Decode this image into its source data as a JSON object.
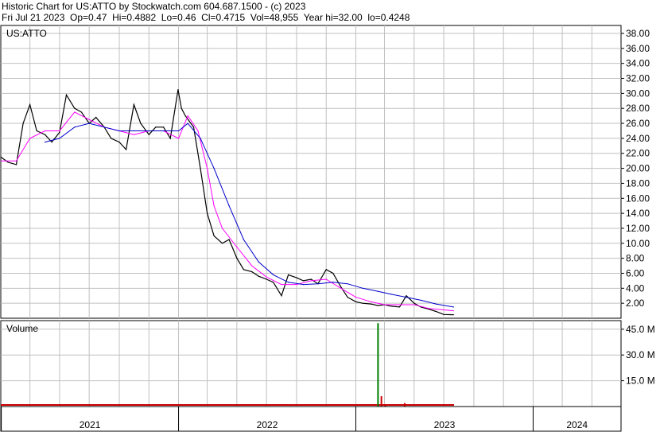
{
  "header": {
    "line1": "Historic Chart for US:ATTO by Stockwatch.com 604.687.1500 - (c) 2023",
    "line2": "Fri Jul 21 2023  Op=0.47  Hi=0.4882  Lo=0.46  Cl=0.4715  Vol=48,955  Year hi=32.00  lo=0.4248"
  },
  "colors": {
    "price": "#000000",
    "ma_short": "#ff00ff",
    "ma_long": "#0000cc",
    "volume_up": "#008000",
    "volume_down": "#cc0000",
    "grid": "#c0c0c0"
  },
  "chart_data": [
    {
      "type": "line",
      "symbol": "US:ATTO",
      "ylim": [
        0,
        38
      ],
      "yticks": [
        "38.00",
        "36.00",
        "34.00",
        "32.00",
        "30.00",
        "28.00",
        "26.00",
        "24.00",
        "22.00",
        "20.00",
        "18.00",
        "16.00",
        "14.00",
        "12.00",
        "10.00",
        "8.00",
        "6.00",
        "4.00",
        "2.00"
      ],
      "x_labels": [
        "2021",
        "2022",
        "2023",
        "2024"
      ],
      "grid": true,
      "series": [
        {
          "role": "price",
          "x": [
            "2020-12-31",
            "2021-01-15",
            "2021-02-01",
            "2021-02-15",
            "2021-03-01",
            "2021-03-15",
            "2021-04-01",
            "2021-04-15",
            "2021-05-01",
            "2021-05-15",
            "2021-06-01",
            "2021-06-15",
            "2021-07-01",
            "2021-07-15",
            "2021-08-01",
            "2021-08-15",
            "2021-09-01",
            "2021-09-15",
            "2021-10-01",
            "2021-10-15",
            "2021-11-01",
            "2021-11-15",
            "2021-12-01",
            "2021-12-15",
            "2021-12-31",
            "2022-01-07",
            "2022-01-15",
            "2022-02-01",
            "2022-02-15",
            "2022-03-01",
            "2022-03-15",
            "2022-04-01",
            "2022-04-15",
            "2022-05-01",
            "2022-05-15",
            "2022-06-01",
            "2022-06-15",
            "2022-07-01",
            "2022-07-15",
            "2022-08-01",
            "2022-08-15",
            "2022-09-01",
            "2022-09-15",
            "2022-10-01",
            "2022-10-15",
            "2022-11-01",
            "2022-11-15",
            "2022-12-01",
            "2022-12-15",
            "2023-01-01",
            "2023-01-15",
            "2023-02-01",
            "2023-02-15",
            "2023-03-01",
            "2023-03-15",
            "2023-04-01",
            "2023-04-15",
            "2023-05-01",
            "2023-05-15",
            "2023-06-01",
            "2023-06-15",
            "2023-07-01",
            "2023-07-21"
          ],
          "values": [
            21.5,
            20.8,
            20.5,
            26,
            28.5,
            25,
            24.5,
            23.5,
            24.8,
            29.8,
            28,
            27.5,
            26,
            26.8,
            25.5,
            24,
            23.5,
            22.5,
            28.5,
            26,
            24.5,
            25.5,
            25.5,
            24,
            30.5,
            28,
            27,
            25.5,
            20,
            14,
            11,
            10,
            10.5,
            8,
            6.5,
            6.2,
            5.6,
            5.2,
            4.8,
            3.0,
            5.8,
            5.4,
            5,
            5.2,
            4.6,
            6.5,
            6,
            4.2,
            2.8,
            2.2,
            2.0,
            1.9,
            1.7,
            1.8,
            1.6,
            1.5,
            3.0,
            2.0,
            1.5,
            1.2,
            0.9,
            0.5,
            0.47
          ]
        },
        {
          "role": "moving-average-short",
          "x": [
            "2021-01-01",
            "2021-02-01",
            "2021-03-01",
            "2021-04-01",
            "2021-05-01",
            "2021-06-01",
            "2021-07-01",
            "2021-08-01",
            "2021-09-01",
            "2021-10-01",
            "2021-11-01",
            "2021-12-01",
            "2022-01-01",
            "2022-01-20",
            "2022-02-10",
            "2022-03-01",
            "2022-03-15",
            "2022-04-01",
            "2022-05-01",
            "2022-06-01",
            "2022-07-01",
            "2022-08-01",
            "2022-09-01",
            "2022-10-01",
            "2022-11-01",
            "2022-12-01",
            "2023-01-01",
            "2023-02-01",
            "2023-03-01",
            "2023-04-01",
            "2023-05-01",
            "2023-06-01",
            "2023-07-21"
          ],
          "values": [
            21,
            21,
            24,
            25,
            25,
            27.5,
            26.5,
            25.5,
            25,
            24.5,
            25,
            25,
            24,
            27,
            25,
            20,
            15,
            12,
            9.5,
            7,
            5.5,
            4.5,
            4.5,
            5,
            5.2,
            4,
            2.8,
            2.2,
            1.8,
            1.8,
            1.8,
            1.3,
            1.0
          ]
        },
        {
          "role": "moving-average-long",
          "x": [
            "2021-04-01",
            "2021-05-01",
            "2021-06-01",
            "2021-07-01",
            "2021-08-01",
            "2021-09-01",
            "2021-10-01",
            "2021-11-01",
            "2021-12-01",
            "2022-01-01",
            "2022-01-20",
            "2022-02-15",
            "2022-03-15",
            "2022-04-15",
            "2022-05-15",
            "2022-06-15",
            "2022-07-15",
            "2022-08-15",
            "2022-09-15",
            "2022-10-15",
            "2022-11-15",
            "2022-12-15",
            "2023-01-15",
            "2023-02-15",
            "2023-03-15",
            "2023-04-15",
            "2023-05-15",
            "2023-06-15",
            "2023-07-21"
          ],
          "values": [
            23.5,
            24,
            25.5,
            26,
            25.5,
            25,
            25,
            25,
            25,
            25,
            26,
            24,
            20,
            15,
            10.5,
            7.5,
            5.8,
            4.8,
            4.5,
            4.6,
            4.8,
            4.6,
            4,
            3.6,
            3.2,
            2.8,
            2.4,
            1.9,
            1.5
          ]
        }
      ]
    },
    {
      "type": "bar",
      "title": "Volume",
      "ylim": [
        0,
        50
      ],
      "yticks": [
        "45.0 M",
        "30.0 M",
        "15.0 M"
      ],
      "series": [
        {
          "name": "Volume",
          "x": [
            "2023-02-14",
            "2023-02-21",
            "2023-04-10",
            "2023-03-01"
          ],
          "values": [
            48.5,
            6.0,
            2.0,
            1.0
          ]
        }
      ]
    }
  ]
}
